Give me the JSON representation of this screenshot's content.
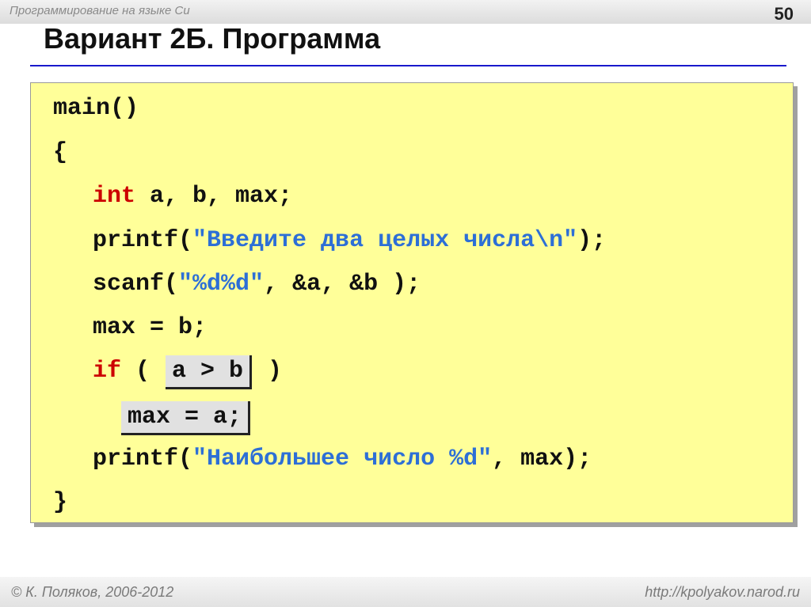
{
  "header": {
    "course": "Программирование на языке Си",
    "page_number": "50"
  },
  "title": "Вариант 2Б. Программа",
  "code": {
    "line1": "main()",
    "line2": "{",
    "line3_kw": "int",
    "line3_rest": " a, b, max;",
    "line4_pre": "printf(",
    "line4_str": "\"Введите два целых числа\\n\"",
    "line4_post": ");",
    "line5_pre": "scanf(",
    "line5_str": "\"%d%d\"",
    "line5_post": ", &a, &b );",
    "line6": "max = b;",
    "line7_kw": "if",
    "line7_open": " ( ",
    "line7_blank": "a > b",
    "line7_close": " )",
    "line8_blank": "max = a;",
    "line9_pre": "printf(",
    "line9_str": "\"Наибольшее число %d\"",
    "line9_post": ", max);",
    "line10": "}"
  },
  "footer": {
    "author": "© К. Поляков, 2006-2012",
    "site": "http://kpolyakov.narod.ru"
  },
  "colors": {
    "code_background": "#ffff99",
    "keyword": "#cc0000",
    "string": "#2d6fd6",
    "title_rule": "#1a1acc"
  }
}
